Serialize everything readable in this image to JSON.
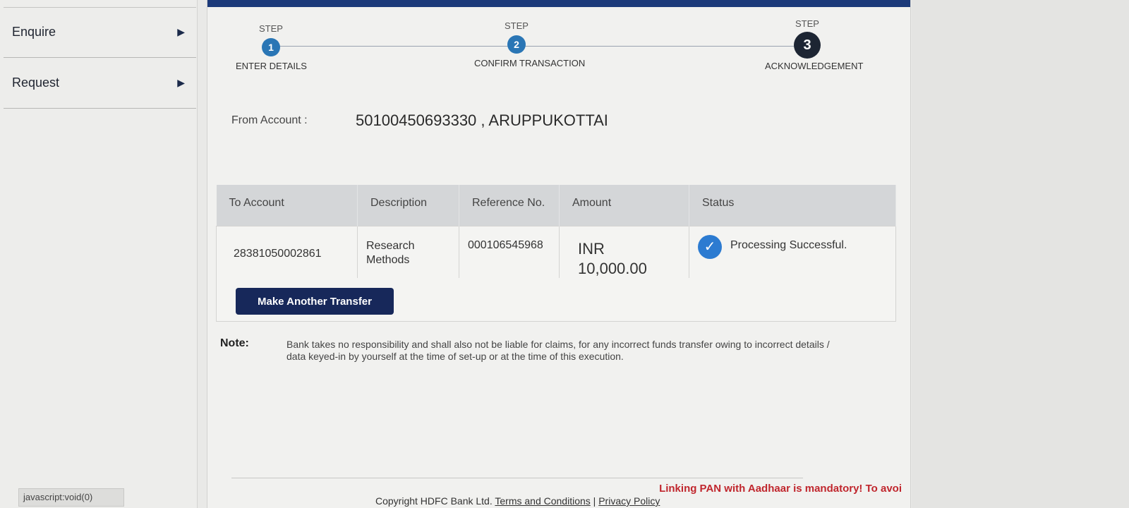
{
  "sidebar": {
    "items": [
      {
        "label": "Enquire",
        "icon": "triangle-right-icon"
      },
      {
        "label": "Request",
        "icon": "triangle-right-icon"
      }
    ],
    "status_url": "javascript:void(0)"
  },
  "stepper": {
    "steps": [
      {
        "word": "STEP",
        "number": "1",
        "name": "ENTER DETAILS"
      },
      {
        "word": "STEP",
        "number": "2",
        "name": "CONFIRM TRANSACTION"
      },
      {
        "word": "STEP",
        "number": "3",
        "name": "ACKNOWLEDGEMENT"
      }
    ],
    "active_step": 3
  },
  "from_account": {
    "label": "From Account :",
    "value": "50100450693330 , ARUPPUKOTTAI"
  },
  "table": {
    "headers": [
      "To Account",
      "Description",
      "Reference No.",
      "Amount",
      "Status"
    ],
    "rows": [
      {
        "to_account": "28381050002861",
        "description": "Research Methods",
        "reference": "000106545968",
        "amount_currency": "INR",
        "amount_value": "10,000.00",
        "status": "Processing Successful."
      }
    ]
  },
  "actions": {
    "make_another_transfer": "Make Another Transfer"
  },
  "note": {
    "label": "Note:",
    "text": "Bank takes no responsibility and shall also not be liable for claims, for any incorrect funds transfer owing to incorrect details / data keyed-in by yourself at the time of set-up or at the time of this execution."
  },
  "ticker": "Linking PAN with Aadhaar is mandatory! To avoi",
  "footer": {
    "copyright": "Copyright HDFC Bank Ltd.",
    "terms": "Terms and Conditions",
    "separator": "|",
    "privacy": "Privacy Policy"
  },
  "colors": {
    "accent": "#1c3a7a",
    "button": "#17285a",
    "step": "#2a76b5",
    "ticker": "#c0262d",
    "success": "#2c7bd1"
  }
}
